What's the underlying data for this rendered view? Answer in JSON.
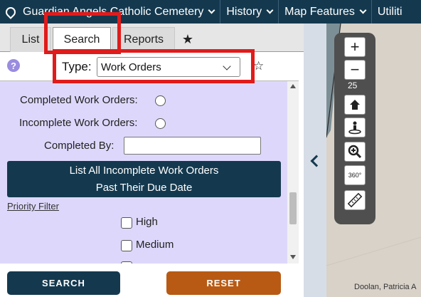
{
  "topnav": {
    "cemetery": "Guardian Angels Catholic Cemetery",
    "history": "History",
    "map_features": "Map Features",
    "utilities": "Utiliti"
  },
  "tabs": {
    "list": "List",
    "search": "Search",
    "reports": "Reports",
    "favorites": "★"
  },
  "type_row": {
    "help": "?",
    "label": "Type:",
    "selected": "Work Orders",
    "favorite": "☆"
  },
  "form": {
    "completed_label": "Completed Work Orders:",
    "incomplete_label": "Incomplete Work Orders:",
    "completed_by_label": "Completed By:",
    "completed_by_value": "",
    "list_button_line1": "List All Incomplete Work Orders",
    "list_button_line2": "Past Their Due Date",
    "priority_filter": "Priority Filter",
    "priorities": [
      "High",
      "Medium"
    ]
  },
  "buttons": {
    "search": "SEARCH",
    "reset": "RESET"
  },
  "map": {
    "zoom_in": "+",
    "zoom_out": "−",
    "zoom_level": "25",
    "rotate_label": "360°",
    "attribution": "Doolan, Patricia A"
  },
  "colors": {
    "nav": "#14394f",
    "form_bg": "#ddd8fb",
    "reset": "#b85a14",
    "highlight": "#e01b1b"
  }
}
